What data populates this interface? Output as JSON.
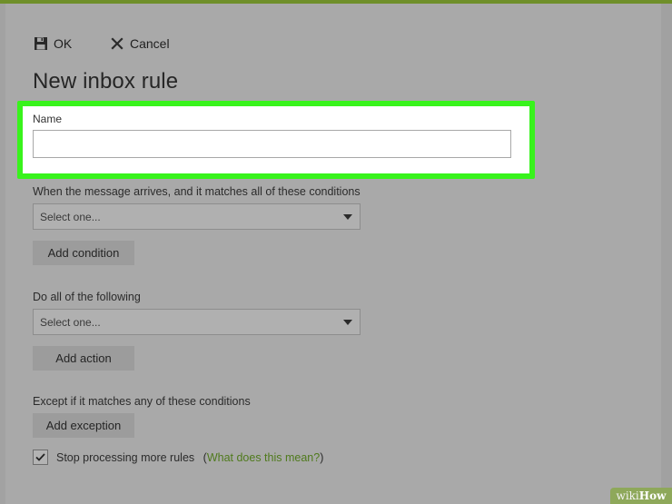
{
  "toolbar": {
    "ok_label": "OK",
    "ok_icon": "save-icon",
    "cancel_label": "Cancel",
    "cancel_icon": "close-icon"
  },
  "title": "New inbox rule",
  "name_field": {
    "label": "Name",
    "value": "",
    "highlight_color": "#38f31c"
  },
  "conditions": {
    "label": "When the message arrives, and it matches all of these conditions",
    "select_value": "Select one...",
    "add_button": "Add condition"
  },
  "actions": {
    "label": "Do all of the following",
    "select_value": "Select one...",
    "add_button": "Add action"
  },
  "exceptions": {
    "label": "Except if it matches any of these conditions",
    "add_button": "Add exception"
  },
  "stop_processing": {
    "checked": true,
    "label": "Stop processing more rules",
    "open_paren": "(",
    "link": "What does this mean?",
    "close_paren": ")"
  },
  "watermark": {
    "part1": "wiki",
    "part2": "How"
  }
}
